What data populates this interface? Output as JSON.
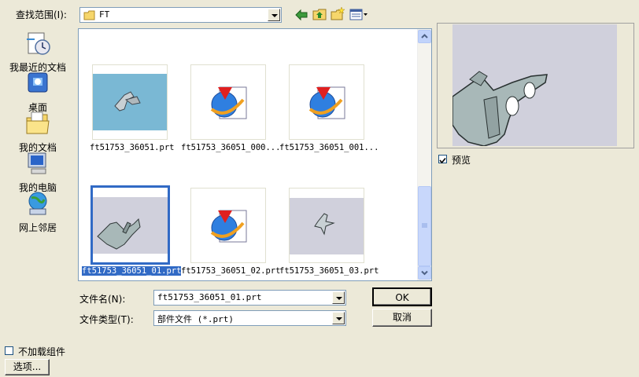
{
  "lookin": {
    "label": "查找范围(I):",
    "value": "FT"
  },
  "toolbar": {
    "back": "back-arrow-icon",
    "up": "up-folder-icon",
    "newfolder": "new-folder-icon",
    "views": "views-menu-icon"
  },
  "places": [
    {
      "label": "我最近的文档",
      "icon": "recent-documents-icon"
    },
    {
      "label": "桌面",
      "icon": "desktop-icon"
    },
    {
      "label": "我的文档",
      "icon": "my-documents-icon"
    },
    {
      "label": "我的电脑",
      "icon": "my-computer-icon"
    },
    {
      "label": "网上邻居",
      "icon": "network-places-icon"
    }
  ],
  "files": [
    {
      "name": "ft51753_36051.prt",
      "thumb": "part-thumbnail-blue"
    },
    {
      "name": "ft51753_36051_000...",
      "thumb": "globe-app-icon"
    },
    {
      "name": "ft51753_36051_001...",
      "thumb": "globe-app-icon"
    },
    {
      "name": "ft51753_36051_01.prt",
      "thumb": "part-thumbnail-gray",
      "selected": true
    },
    {
      "name": "ft51753_36051_02.prt",
      "thumb": "globe-app-icon"
    },
    {
      "name": "ft51753_36051_03.prt",
      "thumb": "part-thumbnail-gray"
    }
  ],
  "filename": {
    "label": "文件名(N):",
    "value": "ft51753_36051_01.prt"
  },
  "filetype": {
    "label": "文件类型(T):",
    "value": "部件文件 (*.prt)"
  },
  "buttons": {
    "ok": "OK",
    "cancel": "取消",
    "options": "选项..."
  },
  "preview": {
    "label": "预览",
    "checked": true
  },
  "noload": {
    "label": "不加载组件",
    "checked": false
  },
  "colors": {
    "selection": "#316ac5",
    "preview_bg": "#d0d0dc",
    "thumb_blue": "#7ab8d4"
  }
}
